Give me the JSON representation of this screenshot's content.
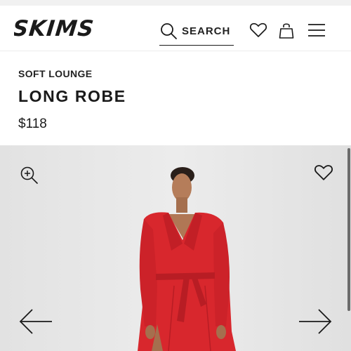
{
  "brand": {
    "name": "SKIMS"
  },
  "header": {
    "search_label": "SEARCH"
  },
  "product": {
    "category": "SOFT LOUNGE",
    "title": "LONG ROBE",
    "price": "$118",
    "robe_color": "#d8272d"
  },
  "icons": {
    "search": "search-icon",
    "wishlist": "heart-icon",
    "bag": "shopping-bag-icon",
    "menu": "hamburger-menu-icon",
    "zoom": "zoom-in-icon",
    "prev": "arrow-left-icon",
    "next": "arrow-right-icon"
  }
}
